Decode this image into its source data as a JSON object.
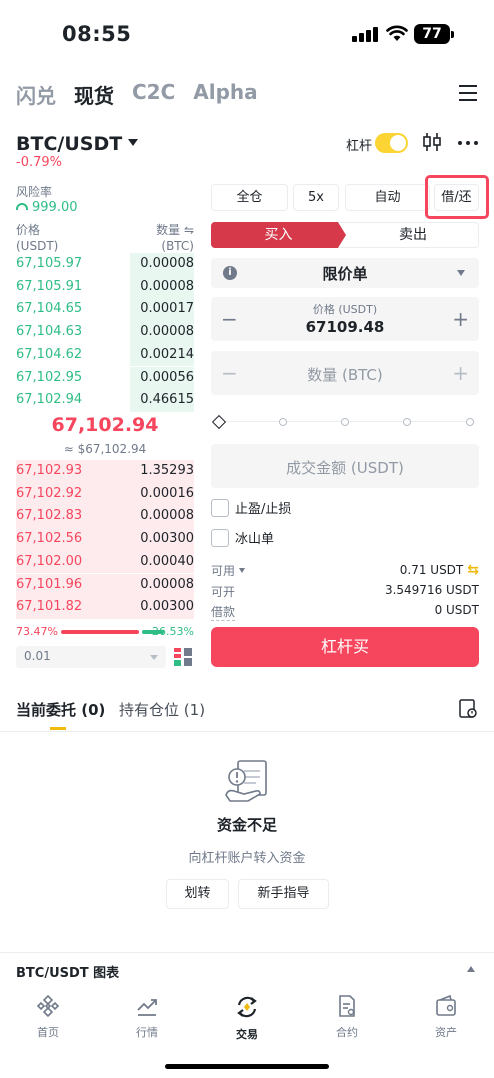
{
  "status": {
    "time": "08:55",
    "battery": "77"
  },
  "top_tabs": [
    "闪兑",
    "现货",
    "C2C",
    "Alpha"
  ],
  "pair": {
    "name": "BTC/USDT",
    "change": "-0.79%",
    "leverage_label": "杠杆",
    "leverage_enabled": true
  },
  "risk": {
    "label": "风险率",
    "value": "999.00"
  },
  "orderbook": {
    "price_header": "价格",
    "price_unit": "(USDT)",
    "qty_header": "数量 ⇋",
    "qty_unit": "(BTC)",
    "asks": [
      {
        "price": "67,105.97",
        "qty": "0.00008"
      },
      {
        "price": "67,105.91",
        "qty": "0.00008"
      },
      {
        "price": "67,104.65",
        "qty": "0.00017"
      },
      {
        "price": "67,104.63",
        "qty": "0.00008"
      },
      {
        "price": "67,104.62",
        "qty": "0.00214"
      },
      {
        "price": "67,102.95",
        "qty": "0.00056"
      },
      {
        "price": "67,102.94",
        "qty": "0.46615"
      }
    ],
    "mid_price": "67,102.94",
    "mid_fiat": "≈ $67,102.94",
    "bids": [
      {
        "price": "67,102.93",
        "qty": "1.35293"
      },
      {
        "price": "67,102.92",
        "qty": "0.00016"
      },
      {
        "price": "67,102.83",
        "qty": "0.00008"
      },
      {
        "price": "67,102.56",
        "qty": "0.00300"
      },
      {
        "price": "67,102.00",
        "qty": "0.00040"
      },
      {
        "price": "67,101.96",
        "qty": "0.00008"
      },
      {
        "price": "67,101.82",
        "qty": "0.00300"
      }
    ],
    "buy_ratio": "73.47%",
    "sell_ratio": "26.53%",
    "depth": "0.01"
  },
  "mode_buttons": {
    "margin": "全仓",
    "leverage": "5x",
    "auto": "自动",
    "borrow": "借/还"
  },
  "side_tabs": {
    "buy": "买入",
    "sell": "卖出"
  },
  "order_type": "限价单",
  "price_field": {
    "label": "价格 (USDT)",
    "value": "67109.48"
  },
  "qty_placeholder": "数量 (BTC)",
  "total_placeholder": "成交金额 (USDT)",
  "checks": {
    "tp_sl": "止盈/止损",
    "iceberg": "冰山单"
  },
  "info": {
    "available_label": "可用",
    "available_value": "0.71 USDT",
    "can_open_label": "可开",
    "can_open_value": "3.549716 USDT",
    "loan_label": "借款",
    "loan_value": "0 USDT"
  },
  "buy_button": "杠杆买",
  "orders": {
    "open_tab": "当前委托",
    "open_count": "(0)",
    "pos_tab": "持有仓位",
    "pos_count": "(1)"
  },
  "empty": {
    "title": "资金不足",
    "subtitle": "向杠杆账户转入资金",
    "transfer_btn": "划转",
    "guide_btn": "新手指导"
  },
  "chart_bar": "BTC/USDT 图表",
  "nav": [
    "首页",
    "行情",
    "交易",
    "合约",
    "资产"
  ],
  "colors": {
    "up": "#2ebd85",
    "down": "#f6465d",
    "accent": "#fcd535"
  },
  "ask_depth_levels": [
    0.36,
    0.36,
    0.36,
    0.36,
    0.36,
    0.36,
    0.36
  ],
  "bid_depth_levels": [
    1,
    1,
    1,
    1,
    1,
    1,
    1
  ]
}
